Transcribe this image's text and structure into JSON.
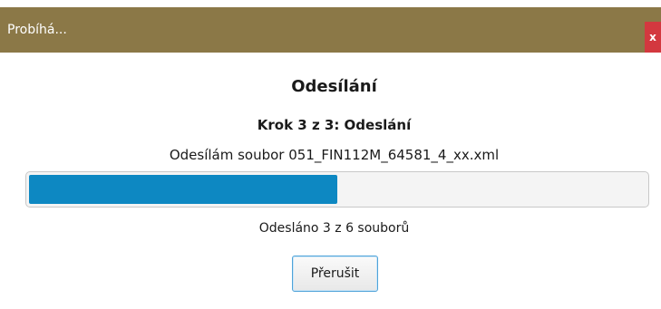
{
  "window": {
    "title": "Probíhá...",
    "close_label": "x"
  },
  "dialog": {
    "heading": "Odesílání",
    "step": "Krok 3 z 3: Odeslání",
    "file_status": "Odesílám soubor 051_FIN112M_64581_4_xx.xml",
    "progress": {
      "sent": 3,
      "total": 6,
      "fraction": 0.5
    },
    "counter_text": "Odesláno 3 z 6 souborů",
    "abort_label": "Přerušit"
  },
  "colors": {
    "titlebar": "#8b7847",
    "close_button": "#d3383f",
    "progress_fill": "#0d88c2"
  }
}
